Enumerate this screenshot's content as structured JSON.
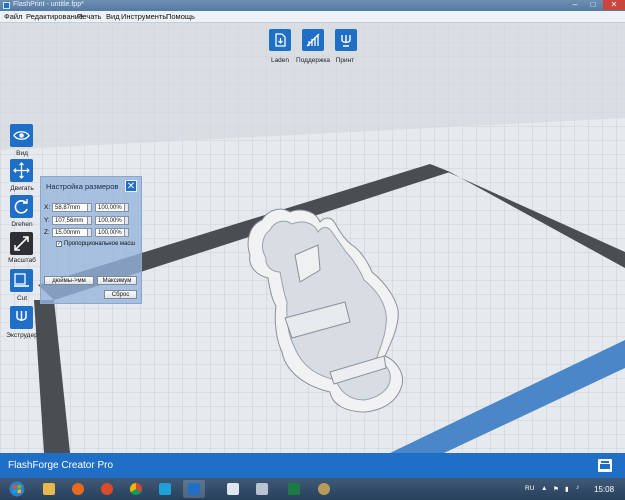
{
  "window": {
    "title": "FlashPrint - untitle.fpp*"
  },
  "menu": {
    "items": [
      "Файл",
      "Редактирование",
      "Печать",
      "Вид",
      "Инструменты",
      "Помощь"
    ]
  },
  "toolbar": {
    "buttons": [
      {
        "label": "Laden",
        "icon": "load-icon"
      },
      {
        "label": "Поддержка",
        "icon": "support-icon"
      },
      {
        "label": "Принт",
        "icon": "print-icon"
      }
    ]
  },
  "sidebar": {
    "items": [
      {
        "label": "Вид",
        "icon": "eye-icon"
      },
      {
        "label": "Двигать",
        "icon": "move-icon"
      },
      {
        "label": "Drehen",
        "icon": "rotate-icon"
      },
      {
        "label": "Масштаб",
        "icon": "scale-icon",
        "active": true
      },
      {
        "label": "Cut",
        "icon": "cut-icon"
      },
      {
        "label": "Экструдер",
        "icon": "extruder-icon"
      }
    ]
  },
  "scale_dialog": {
    "title": "Настройка размеров",
    "rows": [
      {
        "axis": "X:",
        "size": "58,87mm",
        "percent": "100,00%"
      },
      {
        "axis": "Y:",
        "size": "107,56mm",
        "percent": "100,00%"
      },
      {
        "axis": "Z:",
        "size": "15,00mm",
        "percent": "100,00%"
      }
    ],
    "uniform_label": "Пропорциональное масш",
    "uniform_checked": true,
    "inch_button": "дюймы->мм",
    "max_button": "Максимум",
    "reset_button": "Сброс"
  },
  "status": {
    "printer_name": "FlashForge Creator Pro"
  },
  "taskbar": {
    "language": "RU",
    "time": "15:08",
    "apps": [
      "start-icon",
      "explorer-icon",
      "media-icon",
      "chrome-icon",
      "ccleaner-icon",
      "flashprint-icon",
      "document-icon",
      "printer-icon",
      "excel-icon",
      "paint-icon"
    ]
  },
  "colors": {
    "accent": "#1f6fc6",
    "build_area_border": "#4a4e53",
    "plate": "#e4e8ec"
  }
}
